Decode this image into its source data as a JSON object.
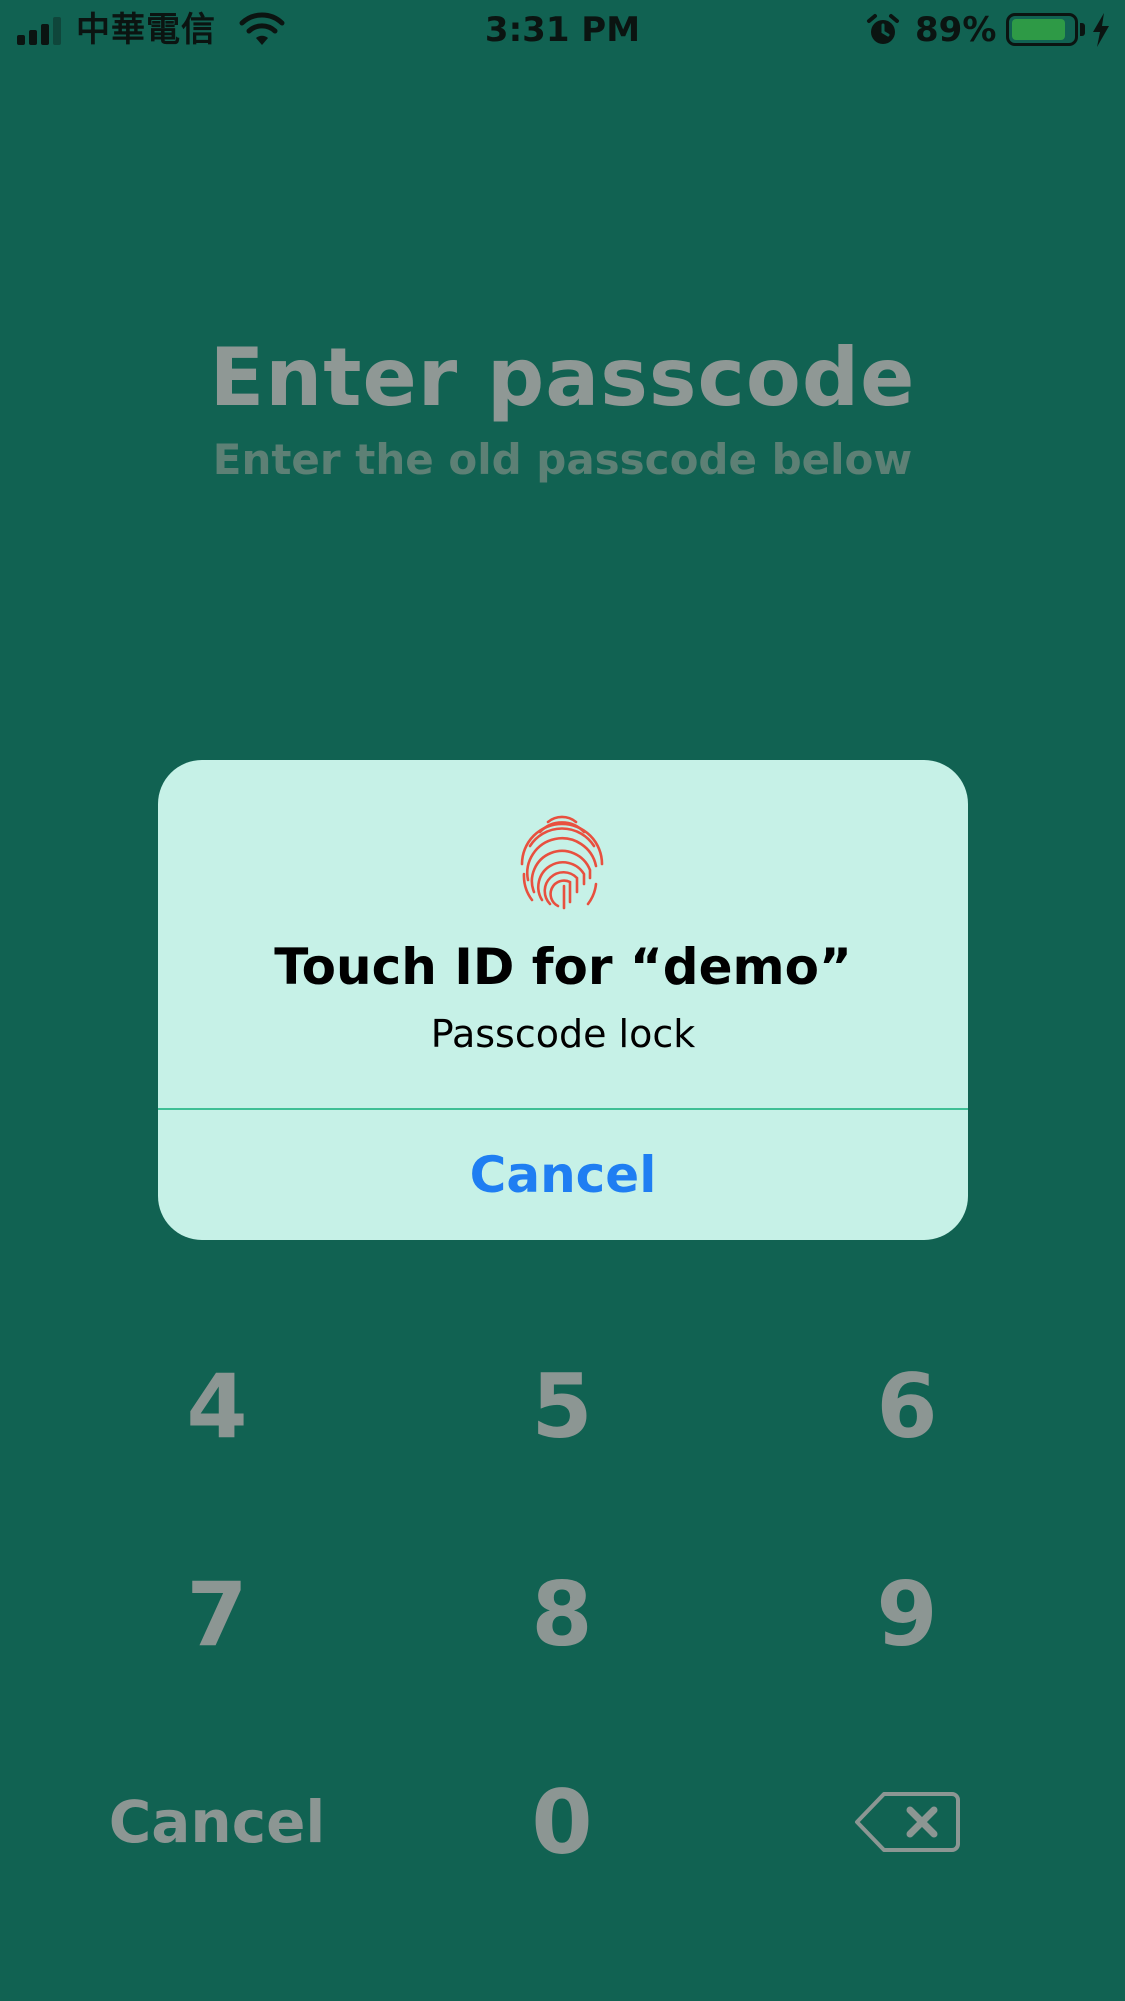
{
  "status_bar": {
    "carrier": "中華電信",
    "time": "3:31 PM",
    "battery_percent": "89%",
    "battery_level": 0.89,
    "signal_bars_active": 3,
    "signal_bars_total": 4,
    "icons": [
      "signal-icon",
      "wifi-icon",
      "alarm-icon",
      "battery-icon",
      "charging-bolt-icon"
    ]
  },
  "header": {
    "title": "Enter passcode",
    "subtitle": "Enter the old passcode below"
  },
  "keypad": {
    "keys": [
      "4",
      "5",
      "6",
      "7",
      "8",
      "9"
    ],
    "cancel_label": "Cancel",
    "zero": "0",
    "delete_icon": "backspace-icon"
  },
  "touch_id_dialog": {
    "icon": "fingerprint-icon",
    "title": "Touch ID for “demo”",
    "message": "Passcode lock",
    "cancel_label": "Cancel"
  },
  "colors": {
    "background": "#116252",
    "dialog_background": "#c6f1e7",
    "accent_blue": "#1f7ef2",
    "fingerprint": "#e8503f",
    "keypad_text": "#8c9693",
    "battery_fill": "#2e9a46"
  }
}
